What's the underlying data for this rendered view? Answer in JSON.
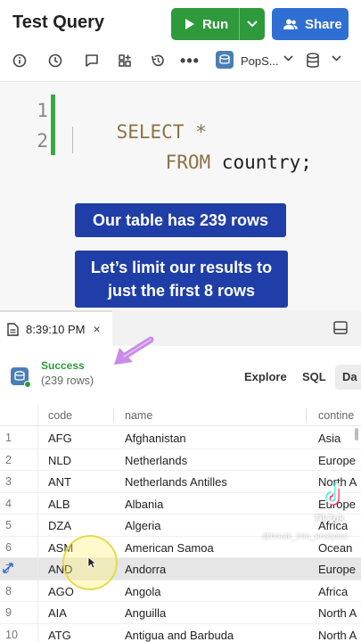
{
  "app": {
    "title": "Test Query",
    "run_label": "Run",
    "share_label": "Share",
    "toolbar_icons": [
      "info-icon",
      "history-clock-icon",
      "comment-icon",
      "widgets-icon",
      "restore-icon",
      "more-dots-icon"
    ],
    "more_glyph": "•••",
    "database": {
      "name": "PopS...",
      "icon": "database-badge-icon"
    }
  },
  "editor": {
    "lines": [
      {
        "number": "1",
        "tokens": [
          {
            "text": "SELECT *",
            "kind": "keyword"
          }
        ]
      },
      {
        "number": "2",
        "tokens": [
          {
            "text": "FROM ",
            "kind": "keyword"
          },
          {
            "text": "country;",
            "kind": "ident"
          }
        ]
      }
    ]
  },
  "overlays": {
    "callout_1": "Our table has 239 rows",
    "callout_2": "Let’s limit our results to just the first 8 rows"
  },
  "results": {
    "tab_time": "8:39:10 PM",
    "tab_close": "×",
    "status": "Success",
    "row_count": "(239 rows)",
    "view_tabs": [
      "Explore",
      "SQL",
      "Da"
    ],
    "columns": [
      "code",
      "name",
      "contine"
    ],
    "rows": [
      {
        "idx": "1",
        "code": "AFG",
        "name": "Afghanistan",
        "continent": "Asia"
      },
      {
        "idx": "2",
        "code": "NLD",
        "name": "Netherlands",
        "continent": "Europe"
      },
      {
        "idx": "3",
        "code": "ANT",
        "name": "Netherlands Antilles",
        "continent": "North A"
      },
      {
        "idx": "4",
        "code": "ALB",
        "name": "Albania",
        "continent": "Europe"
      },
      {
        "idx": "5",
        "code": "DZA",
        "name": "Algeria",
        "continent": "Africa"
      },
      {
        "idx": "6",
        "code": "ASM",
        "name": "American Samoa",
        "continent": "Ocean"
      },
      {
        "idx": "7",
        "code": "AND",
        "name": "Andorra",
        "continent": "Europe"
      },
      {
        "idx": "8",
        "code": "AGO",
        "name": "Angola",
        "continent": "Africa"
      },
      {
        "idx": "9",
        "code": "AIA",
        "name": "Anguilla",
        "continent": "North A"
      },
      {
        "idx": "10",
        "code": "ATG",
        "name": "Antigua and Barbuda",
        "continent": "North A"
      }
    ],
    "highlighted_row": "7"
  },
  "watermark": {
    "brand": "TikTok",
    "handle": "@break_into_analytics"
  },
  "colors": {
    "run_green": "#2e9a3c",
    "share_blue": "#2f6fd3",
    "callout_blue": "#1f3ea8",
    "keyword_brown": "#8b7345",
    "success_green": "#2e9a3c",
    "arrow_purple": "#c98be8"
  }
}
